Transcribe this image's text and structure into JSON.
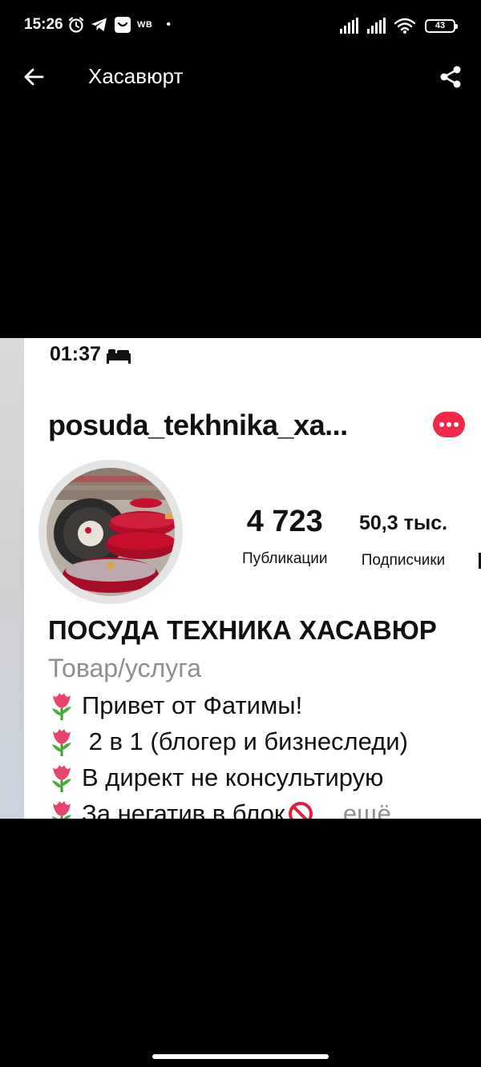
{
  "status_bar": {
    "time": "15:26",
    "carrier_badge": "WB",
    "dot": "•",
    "battery_level": "43",
    "icons": [
      "alarm-icon",
      "telegram-icon",
      "app-badge-icon",
      "signal-icon",
      "signal-icon",
      "wifi-icon",
      "battery-icon"
    ]
  },
  "toolbar": {
    "back_icon": "arrow-left-icon",
    "title": "Хасавюрт",
    "share_icon": "share-icon"
  },
  "screenshot": {
    "time": "01:37",
    "sleep_icon": "bed-icon",
    "username": "posuda_tekhnika_xa...",
    "notifications_icon": "more-dots-icon",
    "stats": [
      {
        "value": "4 723",
        "label": "Публикации"
      },
      {
        "value": "50,3 тыс.",
        "label": "Подписчики"
      }
    ],
    "full_name": "ПОСУДА ТЕХНИКА ХАСАВЮР",
    "category": "Товар/услуга",
    "bio": [
      {
        "icon": "tulip-icon",
        "text": "Привет от Фатимы!"
      },
      {
        "icon": "tulip-icon",
        "text": " 2 в 1 (блогер и бизнеследи)"
      },
      {
        "icon": "tulip-icon",
        "text": "В директ не консультирую"
      },
      {
        "icon": "tulip-icon",
        "text": "За негатив в блок",
        "suffix_icon": "no-entry-icon",
        "more": "... ещё"
      }
    ]
  },
  "colors": {
    "background": "#000000",
    "badge_red": "#f02849",
    "muted_text": "#8e8e8e",
    "pan_red": "#c8102e"
  }
}
